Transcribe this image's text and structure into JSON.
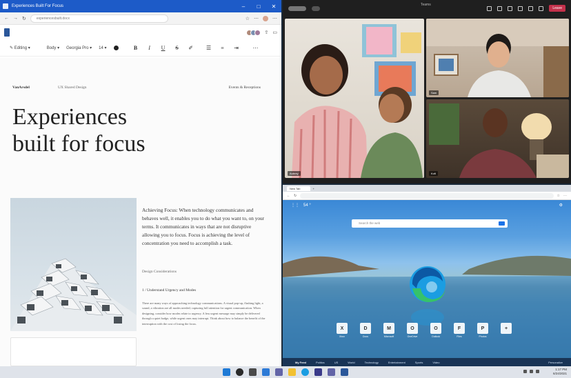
{
  "word": {
    "title": "Experiences Built For Focus",
    "url": "experiencesbuilt.docx",
    "ribbon": {
      "mode": "Editing",
      "style": "Body",
      "font": "Georgia Pro",
      "size": "14"
    },
    "doc": {
      "brand": "VanArsdel",
      "subtitle": "UX Shared Design",
      "header_right": "Events & Receptions",
      "title_line1": "Experiences",
      "title_line2": "built for focus",
      "body": "Achieving Focus: When technology communicates and behaves well, it enables you to do what you want to, on your terms. It communicates in ways that are not disruptive allowing you to focus. Focus is achieving the level of concentration you need to accomplish a task.",
      "section_label": "Design Considerations",
      "section_title": "1 / Understand Urgency and Modes",
      "small_text": "There are many ways of approaching technology communications. A visual pop-up, flashing light, a sound, a vibration are all modes needed; capturing full attention for urgent communication. When designing, consider how modes relate to urgency. A less urgent message may simply be delivered through a quiet badge, while urgent ones may interrupt. Think about how to balance the benefit of the interruption with the cost of losing the focus."
    }
  },
  "teams": {
    "title": "Teams",
    "leave_label": "Leave",
    "participants": [
      {
        "name": "Aubrey"
      },
      {
        "name": "Sam"
      },
      {
        "name": "Kofi"
      }
    ]
  },
  "edge": {
    "tab_label": "New Tab",
    "search_placeholder": "Search the web",
    "weather": "54 °",
    "shortcuts": [
      {
        "label": "Xbox",
        "glyph": "X"
      },
      {
        "label": "Docs",
        "glyph": "D"
      },
      {
        "label": "Microsoft",
        "glyph": "M"
      },
      {
        "label": "OneDrive",
        "glyph": "O"
      },
      {
        "label": "Outlook",
        "glyph": "O"
      },
      {
        "label": "Files",
        "glyph": "F"
      },
      {
        "label": "Photos",
        "glyph": "P"
      },
      {
        "label": "",
        "glyph": "+"
      }
    ],
    "footer_items": [
      "My Feed",
      "Politics",
      "US",
      "World",
      "Technology",
      "Entertainment",
      "Sports",
      "Video"
    ],
    "footer_right": "Personalize"
  },
  "taskbar": {
    "time": "1:17 PM",
    "date": "6/24/2021"
  }
}
